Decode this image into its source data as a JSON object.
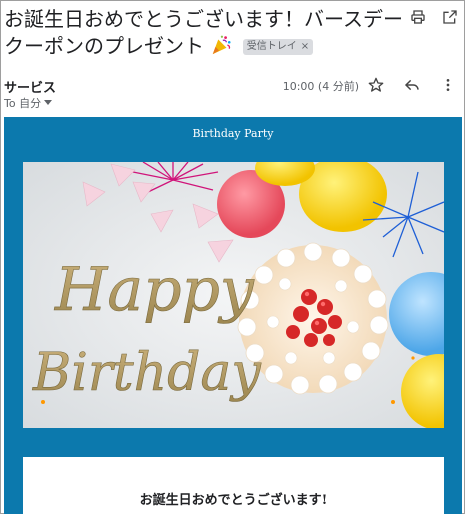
{
  "email": {
    "subject": "お誕生日おめでとうございます！バースデークーポンのプレゼント",
    "label": "受信トレイ",
    "label_close": "×",
    "sender": "サービス",
    "to": "To 自分",
    "time": "10:00 (4 分前)"
  },
  "icons": {
    "print": "print-icon",
    "open_new_window": "open-in-new-window-icon",
    "star": "star-icon",
    "reply": "reply-icon",
    "more": "more-vert-icon",
    "to_dropdown": "caret-down-icon",
    "emoji": "party-popper-emoji"
  },
  "body": {
    "header_title": "Birthday Party",
    "banner_text_line1": "Happy",
    "banner_text_line2": "Birthday",
    "card_heading": "お誕生日おめでとうございます!"
  },
  "colors": {
    "mail_background": "#0c79ad",
    "banner_text_gold": "#b8a064"
  }
}
